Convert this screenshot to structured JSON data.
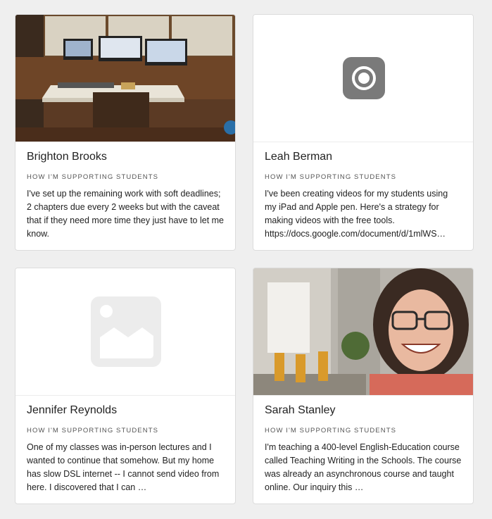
{
  "cards": [
    {
      "name": "Brighton Brooks",
      "label": "HOW I'M SUPPORTING STUDENTS",
      "text": "I've set up the remaining work with soft deadlines; 2 chapters due every 2 weeks but with the caveat that if they need more time they just have to let me know.",
      "media": "photo-desk-workspace"
    },
    {
      "name": "Leah Berman",
      "label": "HOW I'M SUPPORTING STUDENTS",
      "text": "I've been creating videos for my students using my iPad and Apple pen. Here's a strategy for making videos with the free tools. https://docs.google.com/document/d/1mlWS…",
      "media": "record-icon"
    },
    {
      "name": "Jennifer Reynolds",
      "label": "HOW I'M SUPPORTING STUDENTS",
      "text": "One of my classes was in-person lectures and I wanted to continue that somehow.  But my home has slow DSL internet -- I cannot send video from here.  I discovered that I can …",
      "media": "image-placeholder-icon"
    },
    {
      "name": "Sarah Stanley",
      "label": "HOW I'M SUPPORTING STUDENTS",
      "text": "I'm teaching a 400-level English-Education course called Teaching Writing in the Schools. The course was already an asynchronous course and taught online. Our inquiry this …",
      "media": "photo-portrait-smiling"
    }
  ]
}
